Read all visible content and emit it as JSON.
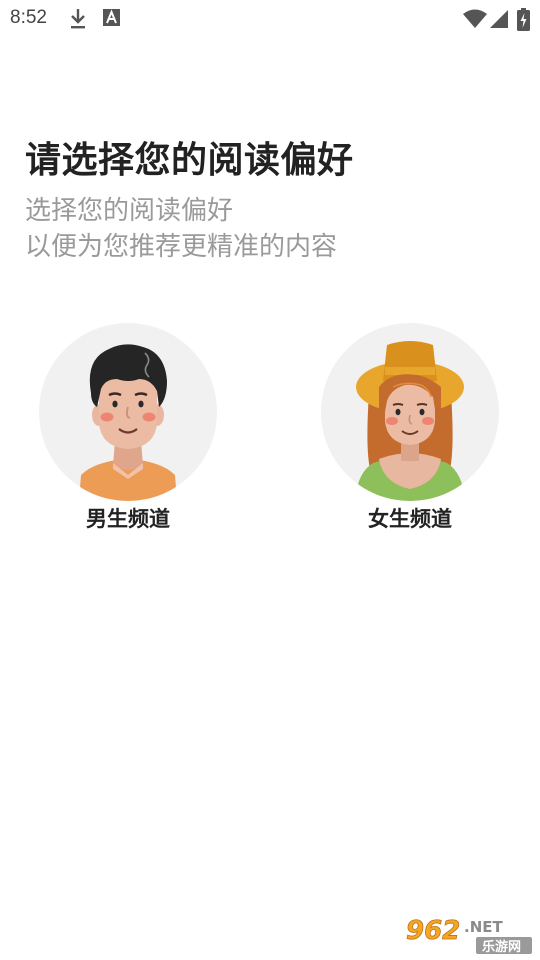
{
  "status_bar": {
    "time": "8:52",
    "icons": [
      "download-icon",
      "font-app-icon",
      "wifi-icon",
      "cellular-signal-icon",
      "battery-charging-icon"
    ]
  },
  "header": {
    "title": "请选择您的阅读偏好",
    "subtitle_line1": "选择您的阅读偏好",
    "subtitle_line2": "以便为您推荐更精准的内容"
  },
  "channels": [
    {
      "label": "男生频道",
      "icon": "male-avatar-icon"
    },
    {
      "label": "女生频道",
      "icon": "female-avatar-icon"
    }
  ],
  "watermark": {
    "brand": "962",
    "suffix": ".NET",
    "sub": "乐游网"
  },
  "colors": {
    "avatar_bg": "#f1f1f1",
    "male_shirt": "#ec9c55",
    "female_hat": "#e8a72c",
    "female_top": "#8dbf5a",
    "skin": "#e8b7a0"
  }
}
